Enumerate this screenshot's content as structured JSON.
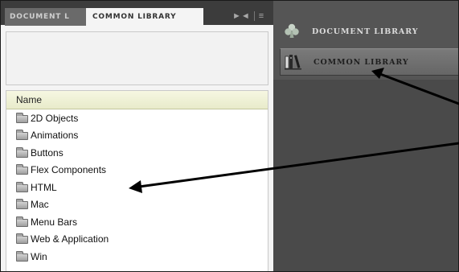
{
  "left_panel": {
    "tabs": [
      {
        "label": "DOCUMENT L"
      },
      {
        "label": "COMMON LIBRARY"
      }
    ],
    "controls": {
      "collapse_icon": "collapse-arrows-icon",
      "menu_icon": "panel-menu-icon"
    },
    "list": {
      "header": "Name",
      "items": [
        {
          "label": "2D Objects",
          "icon": "folder-icon"
        },
        {
          "label": "Animations",
          "icon": "folder-icon"
        },
        {
          "label": "Buttons",
          "icon": "folder-icon"
        },
        {
          "label": "Flex Components",
          "icon": "folder-icon"
        },
        {
          "label": "HTML",
          "icon": "folder-icon"
        },
        {
          "label": "Mac",
          "icon": "folder-icon"
        },
        {
          "label": "Menu Bars",
          "icon": "folder-icon"
        },
        {
          "label": "Web & Application",
          "icon": "folder-icon"
        },
        {
          "label": "Win",
          "icon": "folder-icon"
        }
      ]
    }
  },
  "right_panel": {
    "buttons": [
      {
        "label": "DOCUMENT LIBRARY",
        "icon": "club-icon"
      },
      {
        "label": "COMMON LIBRARY",
        "icon": "books-icon"
      }
    ]
  },
  "colors": {
    "arrow": "#000000",
    "list_header": "#ecefd2",
    "dark_panel": "#4a4a4a"
  }
}
